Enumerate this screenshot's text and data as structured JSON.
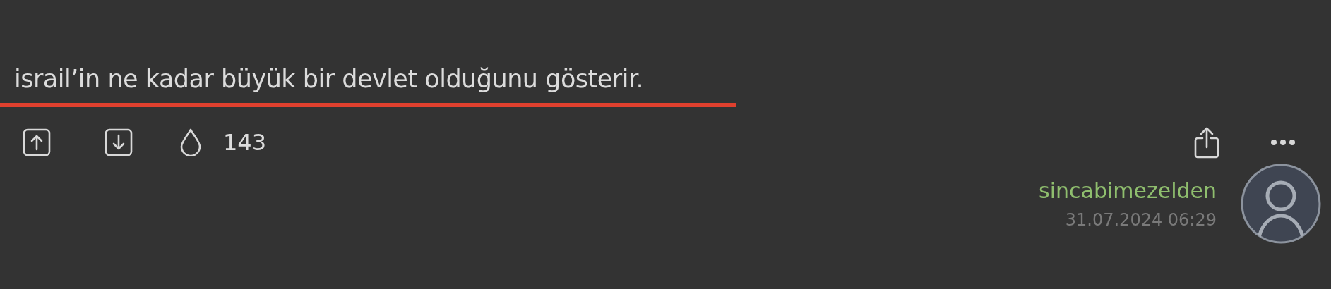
{
  "entry": {
    "text": "israil’in ne kadar büyük bir devlet olduğunu gösterir."
  },
  "actions": {
    "favorite_count": "143"
  },
  "author": {
    "username": "sincabimezelden",
    "date": "31.07.2024 06:29"
  }
}
